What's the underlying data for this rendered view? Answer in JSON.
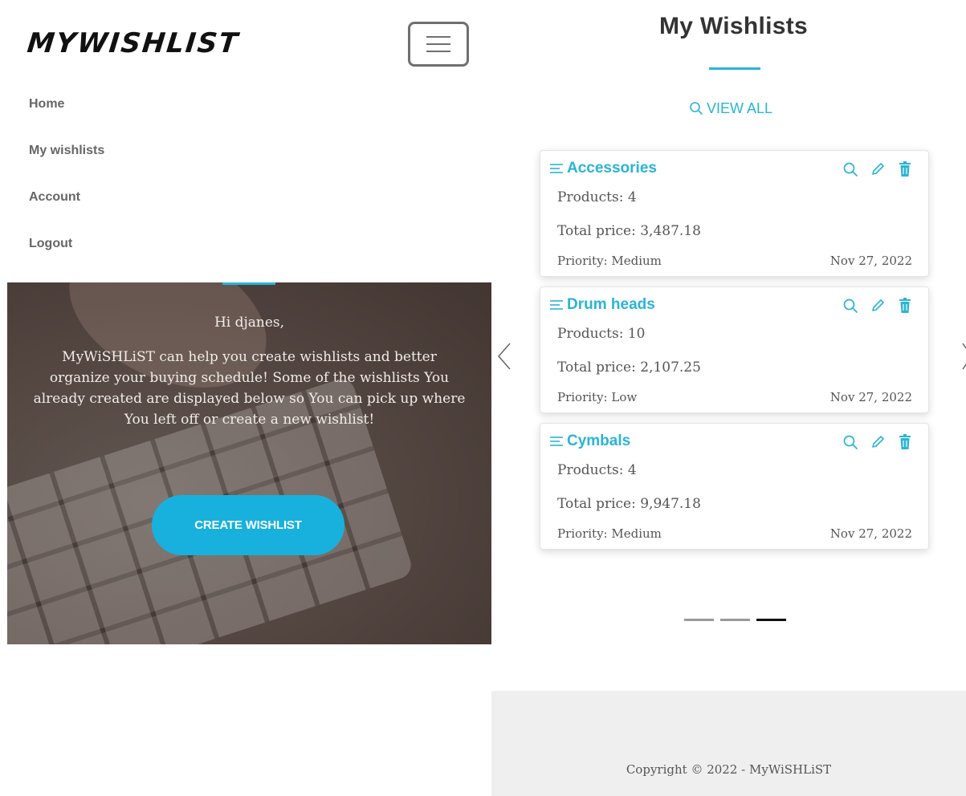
{
  "brand": "MYWISHLIST",
  "nav": {
    "items": [
      "Home",
      "My wishlists",
      "Account",
      "Logout"
    ]
  },
  "hero": {
    "greeting": "Hi djanes,",
    "intro": "MyWiSHLiST can help you create wishlists and better organize your buying schedule! Some of the wishlists You already created are displayed below so You can pick up where You left off or create a new wishlist!",
    "cta_label": "CREATE WISHLIST"
  },
  "wishlists": {
    "title": "My Wishlists",
    "view_all_label": "VIEW ALL",
    "accent_color": "#2ab4d7",
    "cards": [
      {
        "name": "Accessories",
        "products": "Products: 4",
        "total": "Total price: 3,487.18",
        "priority": "Priority: Medium",
        "date": "Nov 27, 2022"
      },
      {
        "name": "Drum heads",
        "products": "Products: 10",
        "total": "Total price: 2,107.25",
        "priority": "Priority: Low",
        "date": "Nov 27, 2022"
      },
      {
        "name": "Cymbals",
        "products": "Products: 4",
        "total": "Total price: 9,947.18",
        "priority": "Priority: Medium",
        "date": "Nov 27, 2022"
      }
    ],
    "carousel": {
      "pages": 3,
      "active_page": 3
    }
  },
  "footer": {
    "copyright": "Copyright © 2022 - MyWiSHLiST"
  },
  "icons": [
    "menu-icon",
    "search-icon",
    "list-icon",
    "edit-icon",
    "trash-icon",
    "chevron-left-icon",
    "chevron-right-icon"
  ]
}
